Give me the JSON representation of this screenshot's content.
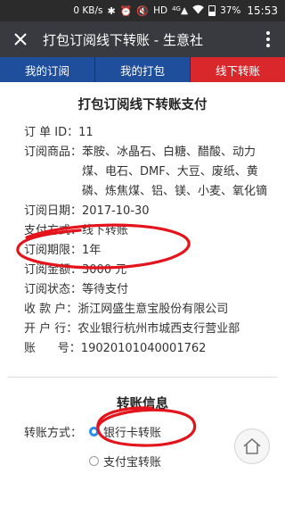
{
  "status_bar": {
    "network_speed": "0 KB/s",
    "icons": [
      "bluetooth-icon",
      "alarm-icon",
      "mute-icon",
      "hd-icon",
      "signal-4g-icon",
      "wifi-icon",
      "battery-icon"
    ],
    "hd_label": "HD",
    "network_type": "4G",
    "battery_percent": "37%",
    "time": "15:53"
  },
  "top_bar": {
    "title": "打包订阅线下转账 - 生意社",
    "background": "#393a3f"
  },
  "tabs": [
    {
      "label": "我的订阅",
      "active": false
    },
    {
      "label": "我的打包",
      "active": false
    },
    {
      "label": "线下转账",
      "active": true
    }
  ],
  "colors": {
    "tab": "#1f4e9c",
    "tab_active": "#d9272c",
    "annotation": "#e3141b",
    "radio_checked": "#2c8ef0"
  },
  "payment_section": {
    "title": "打包订阅线下转账支付",
    "rows": [
      {
        "label": "订 单 ID：",
        "value": "11"
      },
      {
        "label": "订阅商品：",
        "value": "苯胺、冰晶石、白糖、醋酸、动力煤、电石、DMF、大豆、废纸、黄磷、炼焦煤、铝、镁、小麦、氧化镝"
      },
      {
        "label": "订阅日期：",
        "value": "2017-10-30"
      },
      {
        "label": "支付方式：",
        "value": "线下转账"
      },
      {
        "label": "订阅期限：",
        "value": "1年"
      },
      {
        "label": "订阅金额：",
        "value": "3000 元"
      },
      {
        "label": "订阅状态：",
        "value": "等待支付"
      },
      {
        "label": "收 款 户：",
        "value": "浙江网盛生意宝股份有限公司"
      },
      {
        "label": "开 户 行：",
        "value": "农业银行杭州市城西支行营业部"
      },
      {
        "label": "账      号：",
        "value": "19020101040001762"
      }
    ]
  },
  "transfer_section": {
    "title": "转账信息",
    "method_label": "转账方式：",
    "options": [
      {
        "label": "银行卡转账",
        "checked": true
      },
      {
        "label": "支付宝转账",
        "checked": false
      }
    ]
  }
}
